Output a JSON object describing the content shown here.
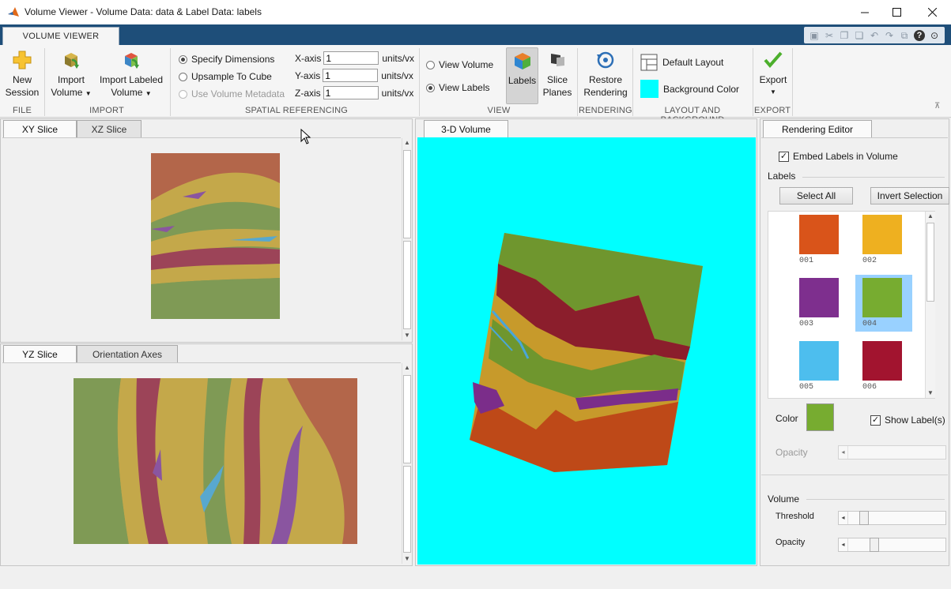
{
  "window": {
    "title": "Volume Viewer - Volume Data: data & Label Data: labels"
  },
  "ribbon": {
    "tab": "VOLUME VIEWER",
    "file": {
      "new_session_l1": "New",
      "new_session_l2": "Session",
      "group": "FILE"
    },
    "import": {
      "import_vol_l1": "Import",
      "import_vol_l2": "Volume",
      "import_lab_l1": "Import Labeled",
      "import_lab_l2": "Volume",
      "group": "IMPORT"
    },
    "spatial": {
      "specify": "Specify Dimensions",
      "upsample": "Upsample To Cube",
      "metadata": "Use Volume Metadata",
      "x_label": "X-axis",
      "y_label": "Y-axis",
      "z_label": "Z-axis",
      "x_value": "1",
      "y_value": "1",
      "z_value": "1",
      "unit": "units/vx",
      "group": "SPATIAL REFERENCING"
    },
    "view": {
      "view_volume": "View Volume",
      "view_labels": "View Labels",
      "labels": "Labels",
      "slice_l1": "Slice",
      "slice_l2": "Planes",
      "group": "VIEW"
    },
    "rendering": {
      "restore_l1": "Restore",
      "restore_l2": "Rendering",
      "group": "RENDERING"
    },
    "layout": {
      "default_layout": "Default Layout",
      "background_color": "Background Color",
      "bg_swatch": "#00ffff",
      "group": "LAYOUT AND BACKGROUND"
    },
    "export": {
      "export": "Export",
      "group": "EXPORT"
    }
  },
  "left": {
    "top_tabs": [
      "XY Slice",
      "XZ Slice"
    ],
    "bottom_tabs": [
      "YZ Slice",
      "Orientation Axes"
    ]
  },
  "center": {
    "tab": "3-D Volume",
    "background": "#00ffff"
  },
  "editor": {
    "tab": "Rendering Editor",
    "embed": "Embed Labels in Volume",
    "labels_heading": "Labels",
    "select_all": "Select All",
    "invert_selection": "Invert Selection",
    "labels": [
      {
        "id": "001",
        "color": "#d9541a"
      },
      {
        "id": "002",
        "color": "#eeb020"
      },
      {
        "id": "003",
        "color": "#7e2f8e"
      },
      {
        "id": "004",
        "color": "#77ac30"
      },
      {
        "id": "005",
        "color": "#4dbeee"
      },
      {
        "id": "006",
        "color": "#a2142f"
      }
    ],
    "selected_label": "004",
    "color_label": "Color",
    "current_color": "#77ac30",
    "show_labels": "Show Label(s)",
    "opacity_label": "Opacity",
    "volume_heading": "Volume",
    "threshold_label": "Threshold",
    "volume_opacity_label": "Opacity",
    "threshold_level": 0.12,
    "volume_opacity_level": 0.23
  }
}
